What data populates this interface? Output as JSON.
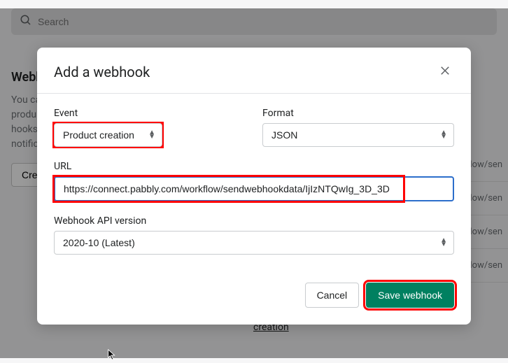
{
  "search": {
    "placeholder": "Search"
  },
  "background": {
    "title": "Webh",
    "text1": "You ca",
    "text2": "produ",
    "text3": "hooks",
    "text4": "notific",
    "button": "Cre",
    "right_items": [
      "flow/sen",
      "flow/sen",
      "flow/sen",
      "flow/sen"
    ],
    "creation": "creation"
  },
  "modal": {
    "title": "Add a webhook",
    "event": {
      "label": "Event",
      "value": "Product creation"
    },
    "format": {
      "label": "Format",
      "value": "JSON"
    },
    "url": {
      "label": "URL",
      "value": "https://connect.pabbly.com/workflow/sendwebhookdata/IjIzNTQwIg_3D_3D"
    },
    "api_version": {
      "label": "Webhook API version",
      "value": "2020-10 (Latest)"
    },
    "cancel_label": "Cancel",
    "save_label": "Save webhook"
  }
}
